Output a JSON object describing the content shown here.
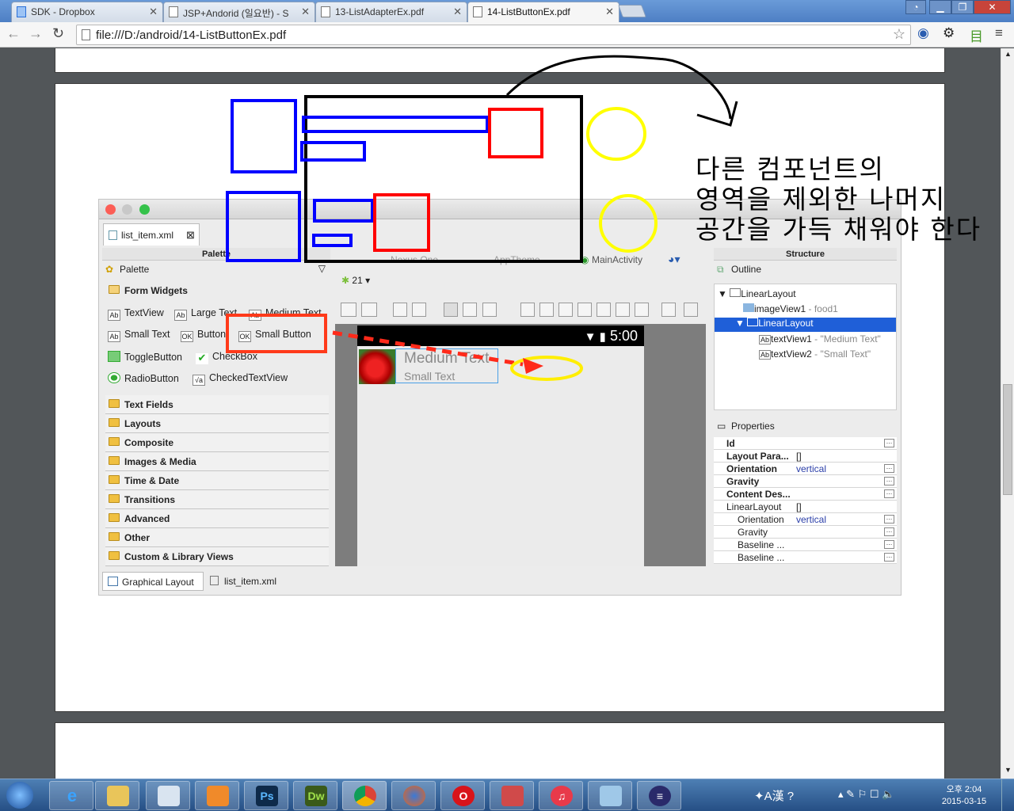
{
  "browser": {
    "tabs": [
      {
        "title": "SDK - Dropbox"
      },
      {
        "title": "JSP+Andorid (일요반) - S"
      },
      {
        "title": "13-ListAdapterEx.pdf"
      },
      {
        "title": "14-ListButtonEx.pdf"
      }
    ],
    "address": "file:///D:/android/14-ListButtonEx.pdf"
  },
  "eclipse": {
    "editor_tab": "list_item.xml",
    "palette": {
      "title": "Palette",
      "header": "Palette",
      "group_open": "Form Widgets",
      "widgets": [
        "TextView",
        "Large Text",
        "Medium Text",
        "Small Text",
        "Button",
        "Small Button",
        "ToggleButton",
        "CheckBox",
        "RadioButton",
        "CheckedTextView"
      ],
      "groups": [
        "Text Fields",
        "Layouts",
        "Composite",
        "Images & Media",
        "Time & Date",
        "Transitions",
        "Advanced",
        "Other",
        "Custom & Library Views"
      ]
    },
    "canvas": {
      "device": "Nexus One",
      "theme": "AppTheme",
      "activity": "MainActivity",
      "api": "21",
      "status_time": "5:00",
      "medium_text": "Medium Text",
      "small_text": "Small Text"
    },
    "structure": {
      "title": "Structure",
      "outline_label": "Outline",
      "tree": [
        {
          "name": "LinearLayout",
          "detail": ""
        },
        {
          "name": "imageView1",
          "detail": " - food1"
        },
        {
          "name": "LinearLayout",
          "detail": ""
        },
        {
          "name": "textView1",
          "detail": " - \"Medium Text\""
        },
        {
          "name": "textView2",
          "detail": " - \"Small Text\""
        }
      ]
    },
    "properties": {
      "title": "Properties",
      "rows": [
        {
          "key": "Id",
          "value": ""
        },
        {
          "key": "Layout Para...",
          "value": "[]"
        },
        {
          "key": "Orientation",
          "value": "vertical"
        },
        {
          "key": "Gravity",
          "value": ""
        },
        {
          "key": "Content Des...",
          "value": ""
        },
        {
          "key": "LinearLayout",
          "value": "[]"
        },
        {
          "key": "Orientation",
          "value": "vertical"
        },
        {
          "key": "Gravity",
          "value": ""
        },
        {
          "key": "Baseline ...",
          "value": ""
        },
        {
          "key": "Baseline ...",
          "value": ""
        }
      ]
    },
    "bottom_tabs": [
      "Graphical Layout",
      "list_item.xml"
    ]
  },
  "annotation_text": [
    "다른 컴포넌트의",
    "영역을 제외한 나머지",
    "공간을 가득 채워야 한다"
  ],
  "taskbar": {
    "clock_time": "오후 2:04",
    "clock_date": "2015-03-15"
  },
  "colors": {
    "blue": "#0000ff",
    "red": "#ff0000",
    "yellow": "#ffff00",
    "selection": "#1f5fd8"
  }
}
